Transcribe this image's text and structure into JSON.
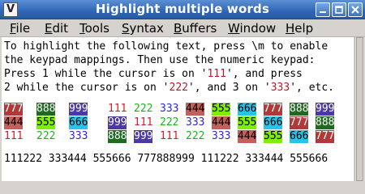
{
  "window": {
    "title": "Highlight multiple words"
  },
  "menu": [
    {
      "mnemonic": "F",
      "rest": "ile"
    },
    {
      "mnemonic": "E",
      "rest": "dit"
    },
    {
      "mnemonic": "T",
      "rest": "ools"
    },
    {
      "mnemonic": "S",
      "rest": "yntax"
    },
    {
      "mnemonic": "B",
      "rest": "uffers"
    },
    {
      "mnemonic": "W",
      "rest": "indow"
    },
    {
      "mnemonic": "H",
      "rest": "elp"
    }
  ],
  "editor": {
    "line1": "To highlight the following text, press \\m to enable",
    "line2": "the keypad mappings. Then use the numeric keypad:",
    "line3": {
      "a": "Press 1 while the cursor is on '",
      "n": "111",
      "b": "', and press"
    },
    "line4": {
      "a": "2 while the cursor is on '",
      "n1": "222",
      "b": "', and 3 on '",
      "n2": "333",
      "c": "', etc."
    },
    "grid": [
      [
        [
          "777",
          "hl-red"
        ],
        [
          "888",
          "hl-green"
        ],
        [
          "999",
          "hl-purple"
        ],
        [
          "111",
          "fg-red"
        ],
        [
          "222",
          "fg-green"
        ],
        [
          "333",
          "fg-blue"
        ],
        [
          "444",
          "hl-brown"
        ],
        [
          "555",
          "hl-lime"
        ],
        [
          "666",
          "hl-cyan"
        ],
        [
          "777",
          "hl-red"
        ],
        [
          "888",
          "hl-green"
        ],
        [
          "999",
          "hl-purple"
        ]
      ],
      [
        [
          "444",
          "hl-brown"
        ],
        [
          "555",
          "hl-lime"
        ],
        [
          "666",
          "hl-cyan"
        ],
        [
          "999",
          "hl-purple"
        ],
        [
          "111",
          "fg-red"
        ],
        [
          "222",
          "fg-green"
        ],
        [
          "333",
          "fg-blue"
        ],
        [
          "444",
          "hl-brown"
        ],
        [
          "555",
          "hl-lime"
        ],
        [
          "666",
          "hl-cyan"
        ],
        [
          "777",
          "hl-red"
        ],
        [
          "888",
          "hl-green"
        ]
      ],
      [
        [
          "111",
          "fg-red"
        ],
        [
          "222",
          "fg-green"
        ],
        [
          "333",
          "fg-blue"
        ],
        [
          "888",
          "hl-green"
        ],
        [
          "999",
          "hl-purple"
        ],
        [
          "111",
          "fg-red"
        ],
        [
          "222",
          "fg-green"
        ],
        [
          "333",
          "fg-blue"
        ],
        [
          "444",
          "hl-brown"
        ],
        [
          "555",
          "hl-lime"
        ],
        [
          "666",
          "hl-cyan"
        ],
        [
          "777",
          "hl-red"
        ]
      ]
    ],
    "last_line": "111222 333444 555666 777888999 111222 333444 555666"
  },
  "colors": {
    "hl-red": {
      "bg": "#b03a3a",
      "fg": "#ffffff"
    },
    "hl-green": {
      "bg": "#1e6a1e",
      "fg": "#ffffff"
    },
    "hl-purple": {
      "bg": "#4b3aa3",
      "fg": "#ffffff"
    },
    "hl-brown": {
      "bg": "#c4605a",
      "fg": "#000000"
    },
    "hl-lime": {
      "bg": "#7cf000",
      "fg": "#000000"
    },
    "hl-cyan": {
      "bg": "#27c3e8",
      "fg": "#000000"
    },
    "fg-red": {
      "bg": "",
      "fg": "#d0202a"
    },
    "fg-green": {
      "bg": "",
      "fg": "#14b814"
    },
    "fg-blue": {
      "bg": "",
      "fg": "#2a2ad6"
    },
    "string": "#b8182a"
  },
  "icons": {
    "app": "vim-icon",
    "minimize": "minimize-icon",
    "maximize": "maximize-icon",
    "close": "close-icon"
  }
}
